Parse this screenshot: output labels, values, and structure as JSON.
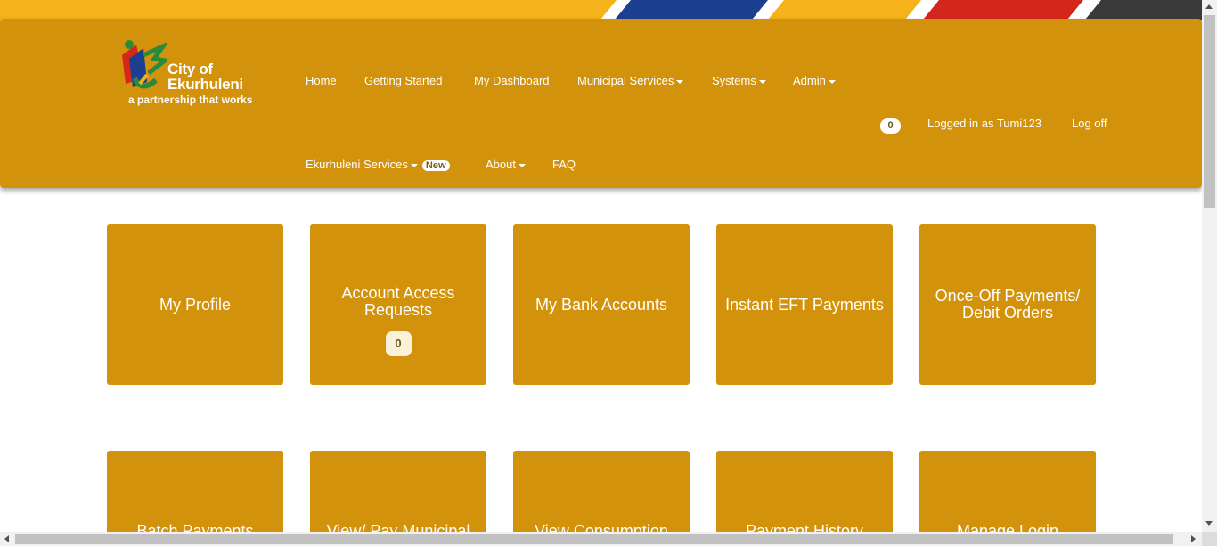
{
  "colors": {
    "brand_gold": "#d3920b",
    "stripe_yellow": "#f5b21a",
    "stripe_blue": "#1d3f8f",
    "stripe_red": "#d3271c",
    "stripe_black": "#3a3a3a"
  },
  "logo": {
    "name_line1": "City of",
    "name_line2": "Ekurhuleni",
    "tagline": "a partnership that works"
  },
  "nav": {
    "home": "Home",
    "getting_started": "Getting Started",
    "my_dashboard": "My Dashboard",
    "municipal_services": "Municipal Services",
    "systems": "Systems",
    "admin": "Admin",
    "notification_count": "0",
    "logged_in": "Logged in as Tumi123",
    "log_off": "Log off",
    "ekurhuleni_services": "Ekurhuleni Services",
    "new_badge": "New",
    "about": "About",
    "faq": "FAQ"
  },
  "tiles": [
    {
      "label": "My Profile"
    },
    {
      "label": "Account Access Requests",
      "badge": "0"
    },
    {
      "label": "My Bank Accounts"
    },
    {
      "label": "Instant EFT Payments"
    },
    {
      "label": "Once-Off Payments/ Debit Orders"
    },
    {
      "label": "Batch Payments"
    },
    {
      "label": "View/ Pay Municipal"
    },
    {
      "label": "View Consumption"
    },
    {
      "label": "Payment History"
    },
    {
      "label": "Manage Login Account"
    }
  ]
}
